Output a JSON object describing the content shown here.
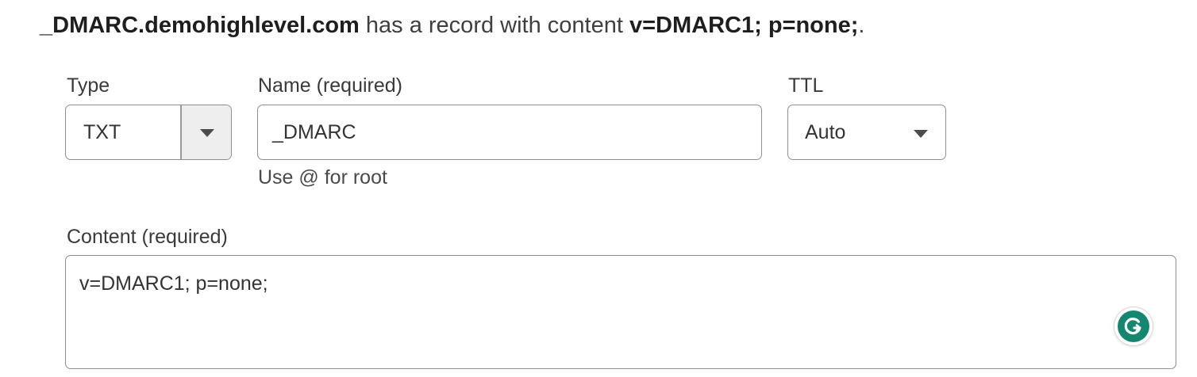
{
  "summary": {
    "domain": "_DMARC.demohighlevel.com",
    "middle": " has a record with content ",
    "content": "v=DMARC1; p=none;",
    "end": "."
  },
  "type_field": {
    "label": "Type",
    "value": "TXT"
  },
  "name_field": {
    "label": "Name (required)",
    "value": "_DMARC",
    "hint": "Use @ for root"
  },
  "ttl_field": {
    "label": "TTL",
    "value": "Auto"
  },
  "content_field": {
    "label": "Content (required)",
    "value": "v=DMARC1; p=none;"
  },
  "icons": {
    "dropdown": "chevron-down-icon",
    "assistant": "grammarly-icon"
  },
  "colors": {
    "assistant_badge": "#15866f",
    "border": "#8f8f8f",
    "dropdown_bg": "#eeeeee"
  }
}
